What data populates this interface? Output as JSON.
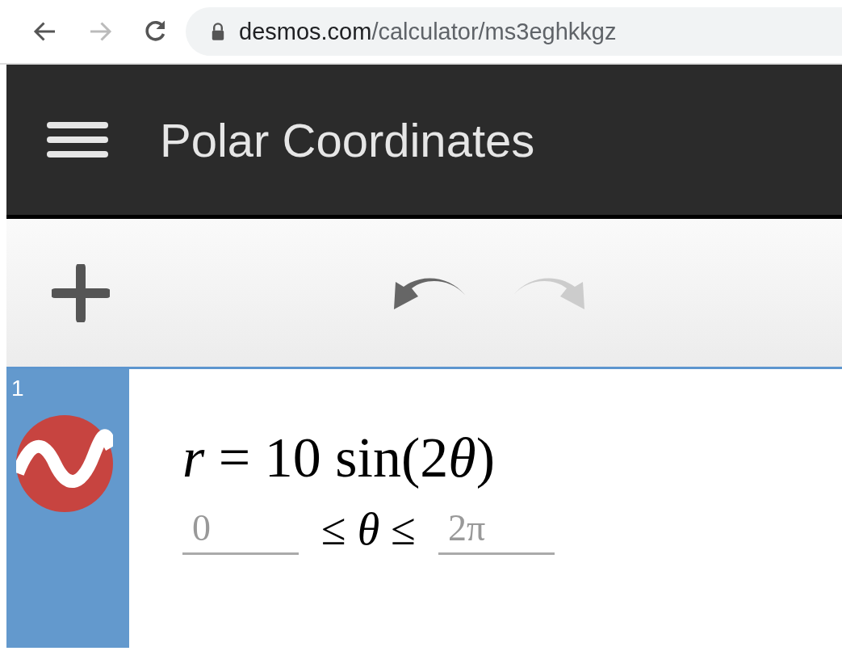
{
  "browser": {
    "url_host": "desmos.com",
    "url_path": "/calculator/ms3eghkkgz",
    "back_enabled": true,
    "forward_enabled": false
  },
  "header": {
    "title": "Polar Coordinates"
  },
  "toolbar": {
    "undo_enabled": true,
    "redo_enabled": false
  },
  "expressions": [
    {
      "index": "1",
      "color": "#c74440",
      "selected": true,
      "formula_parts": [
        {
          "text": "r",
          "italic": true
        },
        {
          "text": " = 10 sin(2",
          "italic": false
        },
        {
          "text": "θ",
          "italic": true
        },
        {
          "text": ")",
          "italic": false
        }
      ],
      "domain_min": "0",
      "domain_relation": "≤ *θ* ≤",
      "domain_max": "2π"
    }
  ]
}
